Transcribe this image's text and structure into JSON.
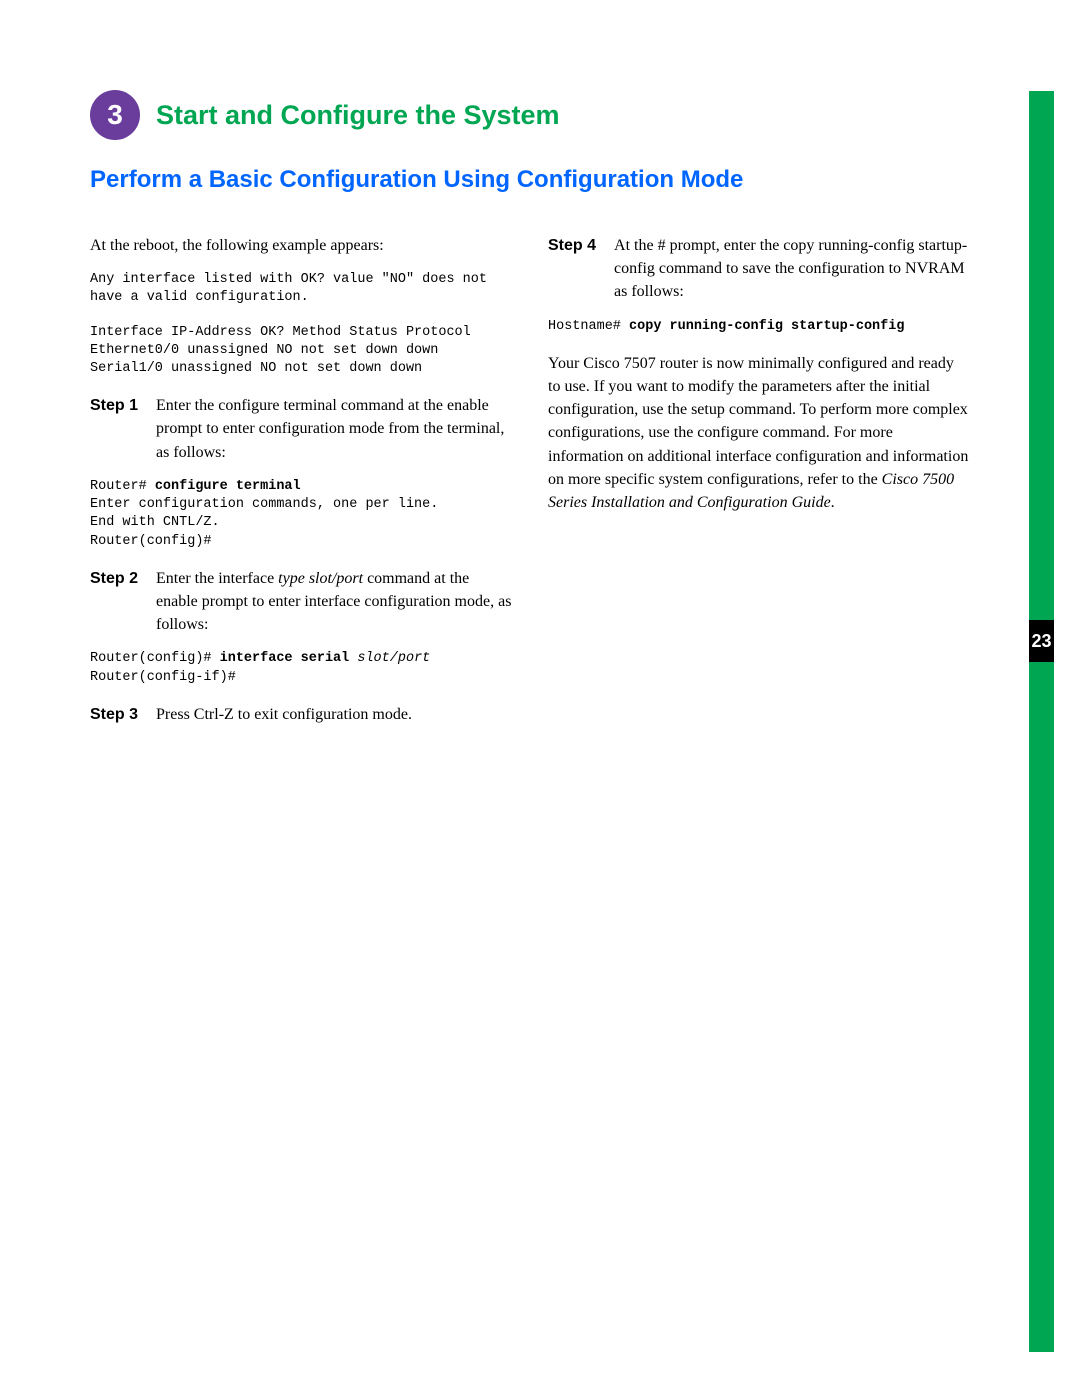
{
  "chapter": {
    "number": "3",
    "title": "Start and Configure the System"
  },
  "section_title": "Perform a Basic Configuration Using Configuration Mode",
  "page_number": "23",
  "left": {
    "intro": "At the reboot, the following example appears:",
    "mono_intro_1": "Any interface listed with OK? value \"NO\" does not have a valid configuration.",
    "mono_intro_2": "Interface IP-Address OK? Method Status Protocol\nEthernet0/0 unassigned NO not set down down\nSerial1/0 unassigned NO not set down down",
    "step1_label": "Step 1",
    "step1_body": "Enter the configure terminal command at the enable prompt to enter configuration mode from the terminal, as follows:",
    "mono_step1_prefix": "Router# ",
    "mono_step1_cmd": "configure terminal",
    "mono_step1_rest": "\nEnter configuration commands, one per line.\nEnd with CNTL/Z.\nRouter(config)#",
    "step2_label": "Step 2",
    "step2_body_a": "Enter the interface ",
    "step2_body_italic": "type slot/port",
    "step2_body_b": " command at the enable prompt to enter interface configuration mode, as follows:",
    "mono_step2_prefix": "Router(config)# ",
    "mono_step2_cmd": "interface serial",
    "mono_step2_space": " ",
    "mono_step2_arg": "slot/port",
    "mono_step2_rest": "\nRouter(config-if)#",
    "step3_label": "Step 3",
    "step3_body": "Press Ctrl-Z to exit configuration mode."
  },
  "right": {
    "step4_label": "Step 4",
    "step4_body": "At the # prompt, enter the copy running-config startup-config command to save the configuration to NVRAM as follows:",
    "mono_step4_prefix": "Hostname# ",
    "mono_step4_cmd": "copy running-config startup-config",
    "closing_a": "Your Cisco 7507 router is now minimally configured and ready to use. If you want to modify the parameters after the initial configuration, use the setup command. To perform more complex configurations, use the configure command. For more information on additional interface configuration and information on more specific system configurations, refer to the ",
    "closing_ref": "Cisco 7500 Series Installation and Configuration Guide",
    "closing_b": "."
  }
}
